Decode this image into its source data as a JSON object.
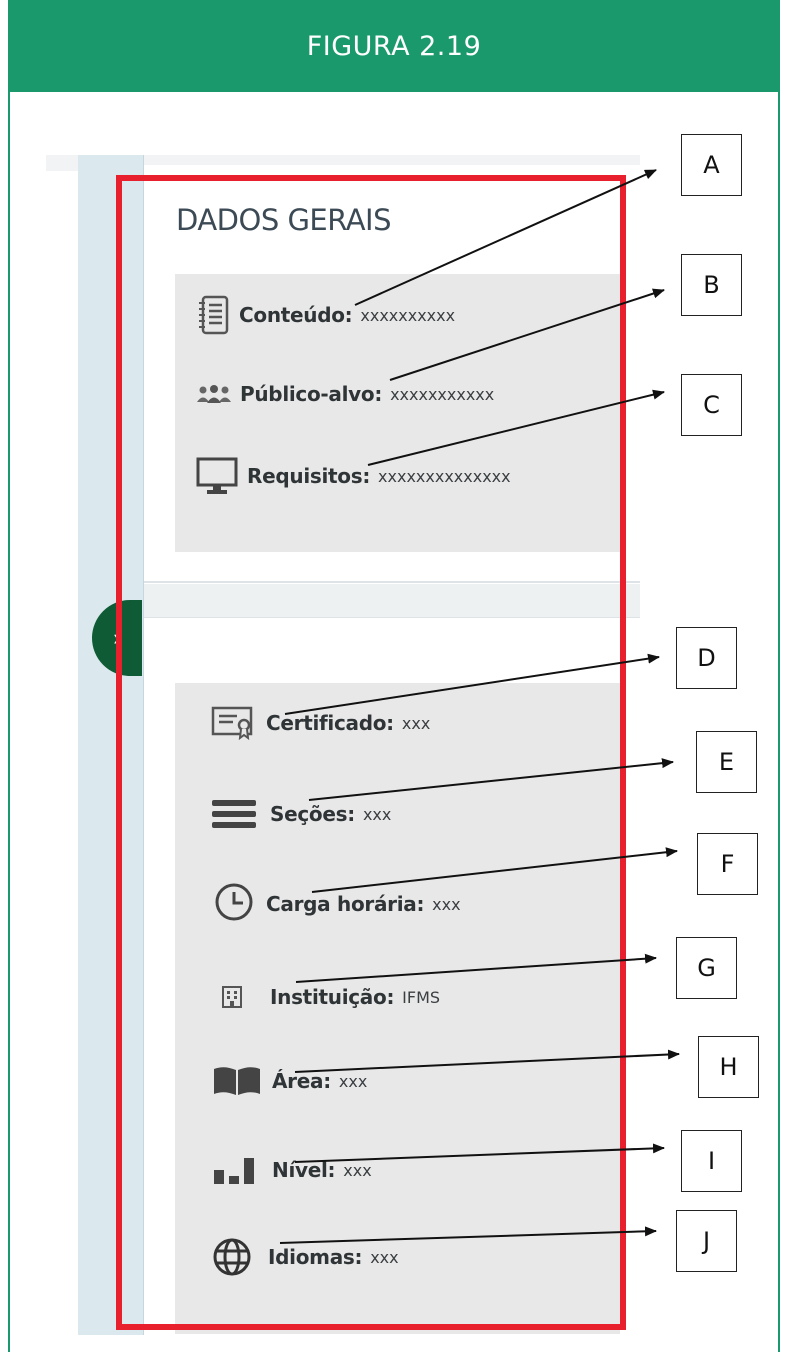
{
  "figure": {
    "title": "FIGURA 2.19"
  },
  "general": {
    "title": "DADOS GERAIS",
    "items": [
      {
        "icon": "notebook-icon",
        "label": "Conteúdo:",
        "value": "xxxxxxxxxx"
      },
      {
        "icon": "users-icon",
        "label": "Público-alvo:",
        "value": "xxxxxxxxxxx"
      },
      {
        "icon": "monitor-icon",
        "label": "Requisitos:",
        "value": "xxxxxxxxxxxxxx"
      }
    ]
  },
  "details": {
    "items": [
      {
        "icon": "certificate-icon",
        "label": "Certificado:",
        "value": "xxx"
      },
      {
        "icon": "sections-icon",
        "label": "Seções:",
        "value": "xxx"
      },
      {
        "icon": "clock-icon",
        "label": "Carga horária:",
        "value": "xxx"
      },
      {
        "icon": "building-icon",
        "label": "Instituição:",
        "value": "IFMS"
      },
      {
        "icon": "book-icon",
        "label": "Área:",
        "value": "xxx"
      },
      {
        "icon": "bar-chart-icon",
        "label": "Nível:",
        "value": "xxx"
      },
      {
        "icon": "globe-icon",
        "label": "Idiomas:",
        "value": "xxx"
      }
    ]
  },
  "toggle": {
    "icon": "chevron-right-icon",
    "glyph": "›"
  },
  "callouts": [
    "A",
    "B",
    "C",
    "D",
    "E",
    "F",
    "G",
    "H",
    "I",
    "J"
  ],
  "colors": {
    "header": "#1a9a6c",
    "highlight": "#e8202e",
    "toggle": "#0f5b35"
  }
}
